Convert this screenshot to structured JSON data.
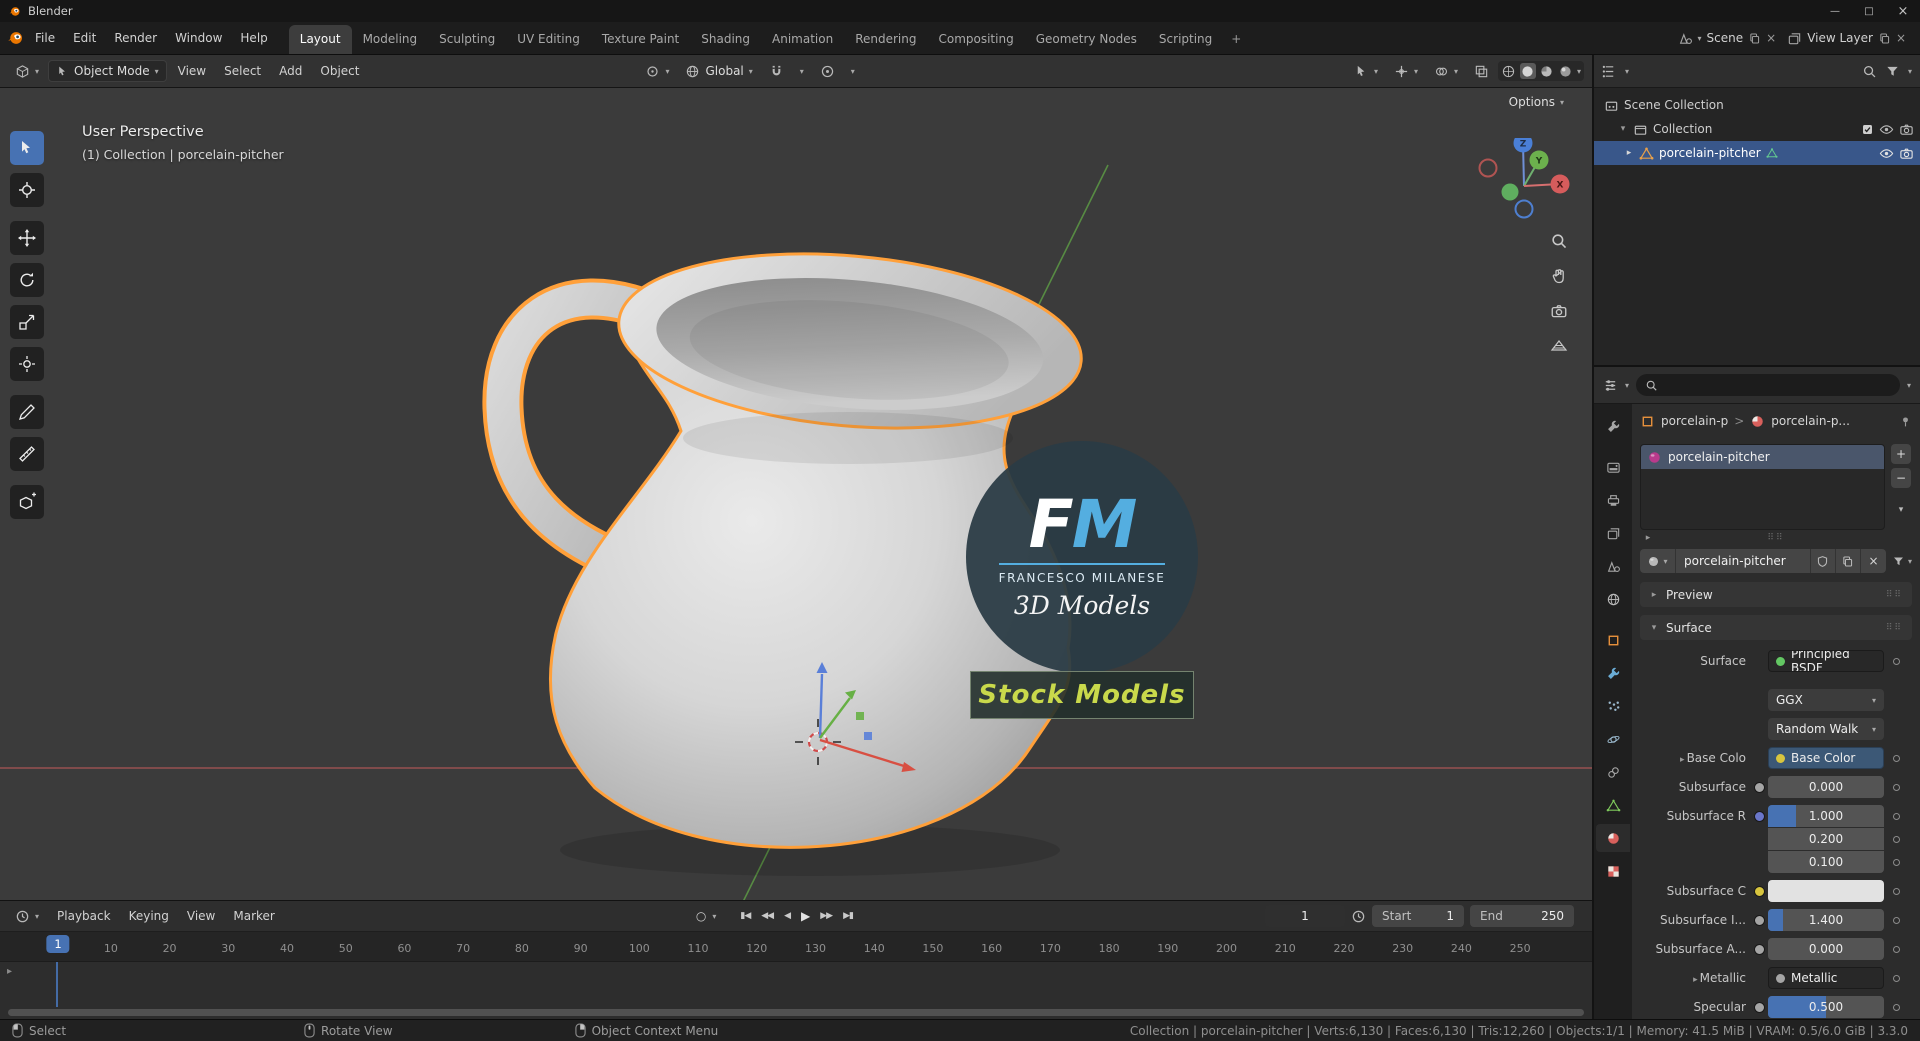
{
  "colors": {
    "accent_blue": "#4772b3",
    "selection_outline": "#ffa03a",
    "watermark_blue": "#54aee0",
    "stock_text": "#c9d94b"
  },
  "icons": {
    "dropdown": "▾",
    "expand": "▸",
    "chev": ">",
    "plus": "+",
    "minus": "−",
    "close": "×",
    "grip": "⠿⠿",
    "record": "○",
    "jump_start": "▮◀",
    "prev_key": "◀◀",
    "play_back": "◀",
    "play": "▶",
    "next_key": "▶▶",
    "jump_end": "▶▮",
    "minimize": "—",
    "maximize": "□"
  },
  "titlebar": {
    "title": "Blender"
  },
  "topbar": {
    "menus": [
      "File",
      "Edit",
      "Render",
      "Window",
      "Help"
    ],
    "workspaces": [
      {
        "label": "Layout",
        "active": true
      },
      {
        "label": "Modeling"
      },
      {
        "label": "Sculpting"
      },
      {
        "label": "UV Editing"
      },
      {
        "label": "Texture Paint"
      },
      {
        "label": "Shading"
      },
      {
        "label": "Animation"
      },
      {
        "label": "Rendering"
      },
      {
        "label": "Compositing"
      },
      {
        "label": "Geometry Nodes"
      },
      {
        "label": "Scripting"
      }
    ],
    "add_workspace": "+",
    "scene_label": "Scene",
    "view_layer_label": "View Layer"
  },
  "viewport_header": {
    "mode": "Object Mode",
    "menus": [
      "View",
      "Select",
      "Add",
      "Object"
    ],
    "orientation": "Global",
    "options_label": "Options"
  },
  "viewport": {
    "view_label": "User Perspective",
    "context_label": "(1) Collection | porcelain-pitcher",
    "axes": {
      "x": "X",
      "y": "Y",
      "z": "Z"
    },
    "watermark": {
      "fm_f": "F",
      "fm_m": "M",
      "name": "FRANCESCO MILANESE",
      "models": "3D Models",
      "stock": "Stock Models"
    }
  },
  "timeline": {
    "menus": [
      "Playback",
      "Keying",
      "View",
      "Marker"
    ],
    "current_frame": "1",
    "playhead": "1",
    "start_label": "Start",
    "start_value": "1",
    "end_label": "End",
    "end_value": "250",
    "ticks": [
      1,
      10,
      20,
      30,
      40,
      50,
      60,
      70,
      80,
      90,
      100,
      110,
      120,
      130,
      140,
      150,
      160,
      170,
      180,
      190,
      200,
      210,
      220,
      230,
      240,
      250
    ]
  },
  "outliner": {
    "scene_collection": "Scene Collection",
    "collection": "Collection",
    "object_name": "porcelain-pitcher"
  },
  "properties": {
    "breadcrumb": {
      "object": "porcelain-p",
      "material": "porcelain-p..."
    },
    "slot_name": "porcelain-pitcher",
    "material_name": "porcelain-pitcher",
    "panels": {
      "preview": "Preview",
      "surface": "Surface"
    },
    "surface": {
      "surface_label": "Surface",
      "surface_value": "Principled BSDF",
      "distribution": "GGX",
      "method": "Random Walk",
      "base_color_label": "Base Colo",
      "base_color_value": "Base Color",
      "subsurface_label": "Subsurface",
      "subsurface_value": "0.000",
      "subsurface_r_label": "Subsurface R",
      "subsurface_r_values": [
        "1.000",
        "0.200",
        "0.100"
      ],
      "subsurface_c_label": "Subsurface C",
      "subsurface_i_label": "Subsurface I...",
      "subsurface_i_value": "1.400",
      "subsurface_a_label": "Subsurface A...",
      "subsurface_a_value": "0.000",
      "metallic_label": "Metallic",
      "metallic_value": "Metallic",
      "specular_label": "Specular",
      "specular_value": "0.500"
    }
  },
  "statusbar": {
    "select": "Select",
    "rotate": "Rotate View",
    "context_menu": "Object Context Menu",
    "stats": "Collection | porcelain-pitcher | Verts:6,130 | Faces:6,130 | Tris:12,260 | Objects:1/1 | Memory: 41.5 MiB | VRAM: 0.5/6.0 GiB | 3.3.0"
  }
}
